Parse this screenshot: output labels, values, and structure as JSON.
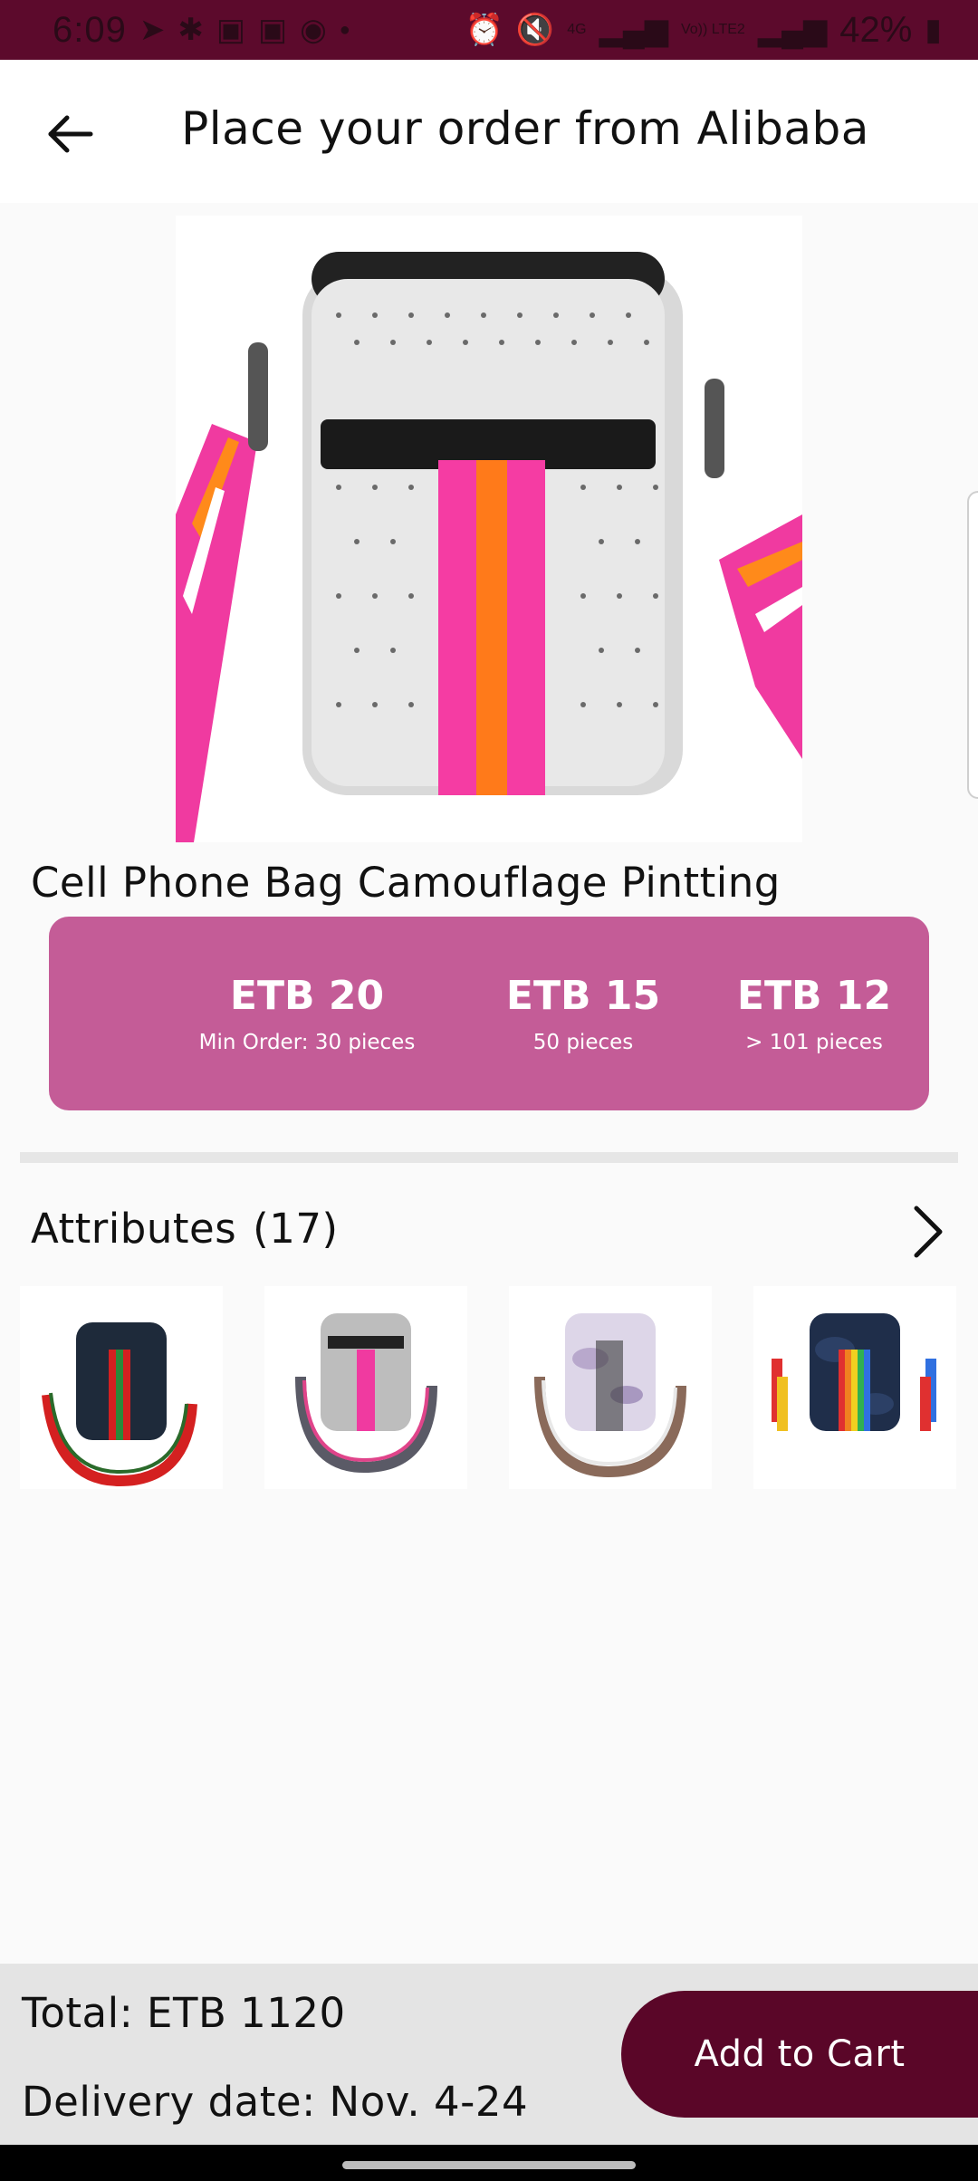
{
  "status_bar": {
    "time": "6:09",
    "signal_4g": "4G",
    "volte": "Vo)) LTE2",
    "battery": "42%"
  },
  "app_bar": {
    "title": "Place your order from Alibaba"
  },
  "product": {
    "name": "Cell Phone Bag Camouflage Pintting",
    "image_icon": "crossbody-phone-bag-image"
  },
  "price_tiers": [
    {
      "price": "ETB 20",
      "note": "Min Order: 30 pieces"
    },
    {
      "price": "ETB 15",
      "note": "50 pieces"
    },
    {
      "price": "ETB 12",
      "note": "> 101 pieces"
    }
  ],
  "attributes": {
    "label": "Attributes",
    "count": "(17)",
    "thumbnails": [
      "navy-red-stripe-bag",
      "grey-pink-stripe-bag",
      "marble-stripe-bag",
      "camo-rainbow-bag"
    ]
  },
  "footer": {
    "total": "Total: ETB 1120",
    "delivery": "Delivery date: Nov. 4-24",
    "add_to_cart": "Add to Cart"
  },
  "colors": {
    "status_bar": "#5c0a2c",
    "accent": "#5a0628",
    "price_panel": "#c45c97"
  }
}
